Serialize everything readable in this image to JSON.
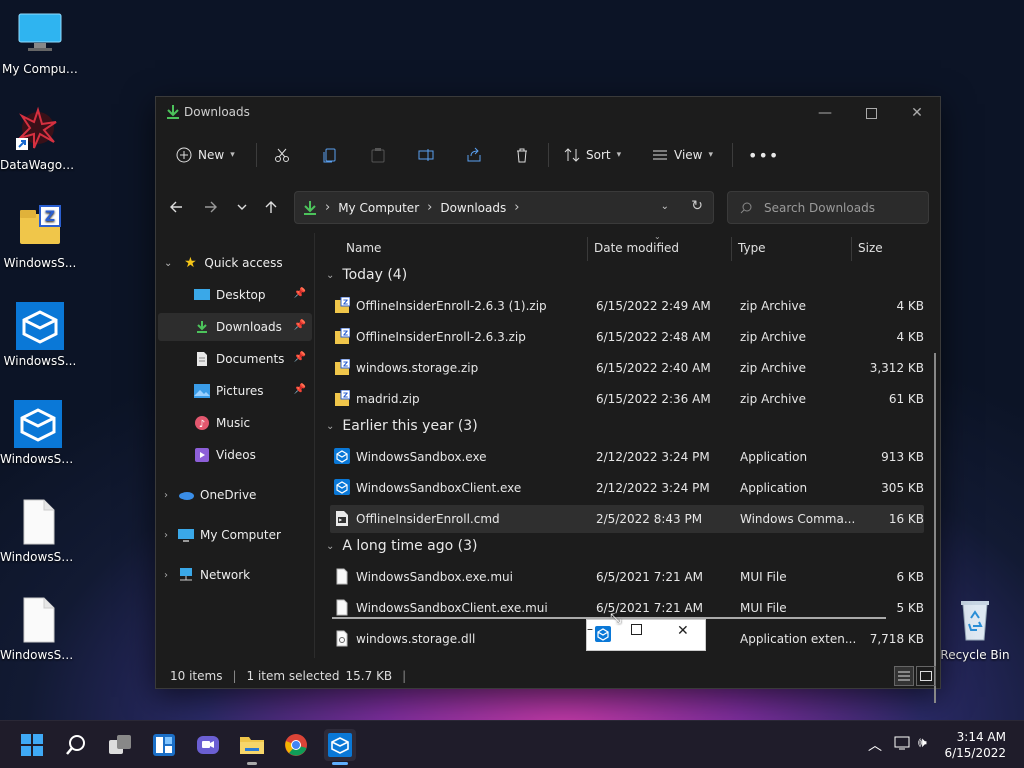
{
  "desktop": {
    "icons": [
      {
        "label": "My Computer",
        "icon": "monitor-icon"
      },
      {
        "label": "DataWagon...",
        "icon": "shortcut-icon"
      },
      {
        "label": "WindowsS...",
        "icon": "zip-folder-icon"
      },
      {
        "label": "WindowsS...",
        "icon": "sandbox-icon"
      },
      {
        "label": "WindowsSa...",
        "icon": "sandbox-icon"
      },
      {
        "label": "WindowsSa...",
        "icon": "file-icon"
      },
      {
        "label": "WindowsSa...",
        "icon": "file-icon"
      }
    ],
    "recycle_bin": "Recycle Bin"
  },
  "window": {
    "title": "Downloads",
    "toolbar": {
      "new_label": "New",
      "sort_label": "Sort",
      "view_label": "View"
    },
    "address": {
      "part1": "My Computer",
      "part2": "Downloads"
    },
    "search_placeholder": "Search Downloads",
    "sidebar": {
      "quick_access": "Quick access",
      "items": [
        {
          "label": "Desktop"
        },
        {
          "label": "Downloads"
        },
        {
          "label": "Documents"
        },
        {
          "label": "Pictures"
        },
        {
          "label": "Music"
        },
        {
          "label": "Videos"
        }
      ],
      "onedrive": "OneDrive",
      "my_computer": "My Computer",
      "network": "Network"
    },
    "columns": {
      "name": "Name",
      "date": "Date modified",
      "type": "Type",
      "size": "Size"
    },
    "groups": [
      {
        "title": "Today (4)",
        "files": [
          {
            "name": "OfflineInsiderEnroll-2.6.3 (1).zip",
            "date": "6/15/2022 2:49 AM",
            "type": "zip Archive",
            "size": "4 KB"
          },
          {
            "name": "OfflineInsiderEnroll-2.6.3.zip",
            "date": "6/15/2022 2:48 AM",
            "type": "zip Archive",
            "size": "4 KB"
          },
          {
            "name": "windows.storage.zip",
            "date": "6/15/2022 2:40 AM",
            "type": "zip Archive",
            "size": "3,312 KB"
          },
          {
            "name": "madrid.zip",
            "date": "6/15/2022 2:36 AM",
            "type": "zip Archive",
            "size": "61 KB"
          }
        ]
      },
      {
        "title": "Earlier this year (3)",
        "files": [
          {
            "name": "WindowsSandbox.exe",
            "date": "2/12/2022 3:24 PM",
            "type": "Application",
            "size": "913 KB"
          },
          {
            "name": "WindowsSandboxClient.exe",
            "date": "2/12/2022 3:24 PM",
            "type": "Application",
            "size": "305 KB"
          },
          {
            "name": "OfflineInsiderEnroll.cmd",
            "date": "2/5/2022 8:43 PM",
            "type": "Windows Comma...",
            "size": "16 KB"
          }
        ]
      },
      {
        "title": "A long time ago (3)",
        "files": [
          {
            "name": "WindowsSandbox.exe.mui",
            "date": "6/5/2021 7:21 AM",
            "type": "MUI File",
            "size": "6 KB"
          },
          {
            "name": "WindowsSandboxClient.exe.mui",
            "date": "6/5/2021 7:21 AM",
            "type": "MUI File",
            "size": "5 KB"
          },
          {
            "name": "windows.storage.dll",
            "date": "",
            "type": "Application exten...",
            "size": "7,718 KB"
          }
        ]
      }
    ],
    "status": {
      "items": "10 items",
      "selected": "1 item selected",
      "size": "15.7 KB"
    }
  },
  "taskbar": {
    "clock_time": "3:14 AM",
    "clock_date": "6/15/2022"
  },
  "colors": {
    "accent": "#0a78d7",
    "window_bg": "#1c1c1c",
    "folder_yellow": "#f0c64a",
    "zip_blue": "#2b5fd0"
  }
}
